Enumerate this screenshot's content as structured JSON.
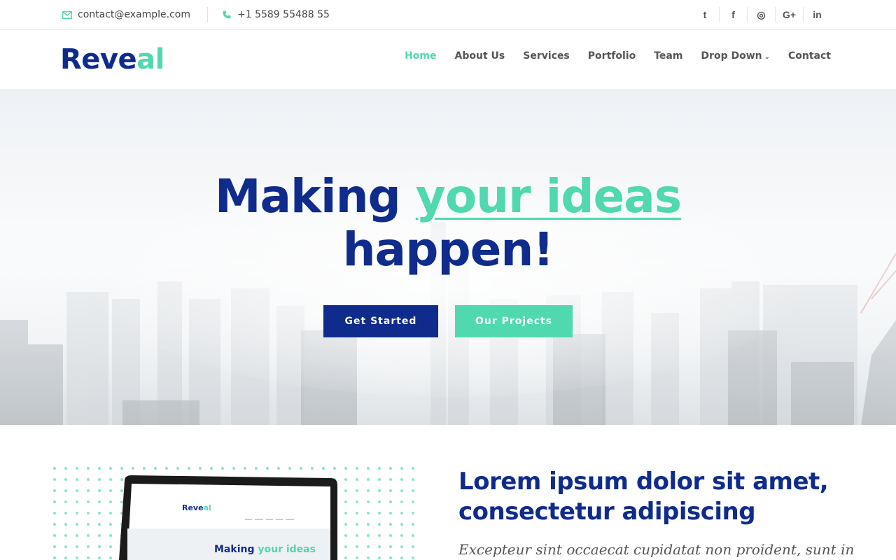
{
  "topbar": {
    "email": "contact@example.com",
    "phone": "+1 5589 55488 55",
    "social": [
      {
        "icon": "twitter-icon",
        "glyph": "t"
      },
      {
        "icon": "facebook-icon",
        "glyph": "f"
      },
      {
        "icon": "instagram-icon",
        "glyph": "◎"
      },
      {
        "icon": "google-plus-icon",
        "glyph": "G+"
      },
      {
        "icon": "linkedin-icon",
        "glyph": "in"
      }
    ]
  },
  "header": {
    "logo_main": "Reve",
    "logo_accent": "al",
    "nav": [
      {
        "label": "Home",
        "active": true
      },
      {
        "label": "About Us"
      },
      {
        "label": "Services"
      },
      {
        "label": "Portfolio"
      },
      {
        "label": "Team"
      },
      {
        "label": "Drop Down",
        "dropdown": true
      },
      {
        "label": "Contact"
      }
    ]
  },
  "hero": {
    "title_start": "Making ",
    "title_highlight": "your ideas",
    "title_end": "happen!",
    "primary_button": "Get Started",
    "secondary_button": "Our Projects"
  },
  "about": {
    "heading": "Lorem ipsum dolor sit amet, consectetur adipiscing",
    "lead": "Excepteur sint occaecat cupidatat non proident, sunt in",
    "mockup_logo_main": "Reve",
    "mockup_logo_accent": "al",
    "mockup_title_start": "Making ",
    "mockup_title_highlight": "your ideas"
  },
  "colors": {
    "brand": "#0f2b8c",
    "accent": "#50d8af"
  }
}
